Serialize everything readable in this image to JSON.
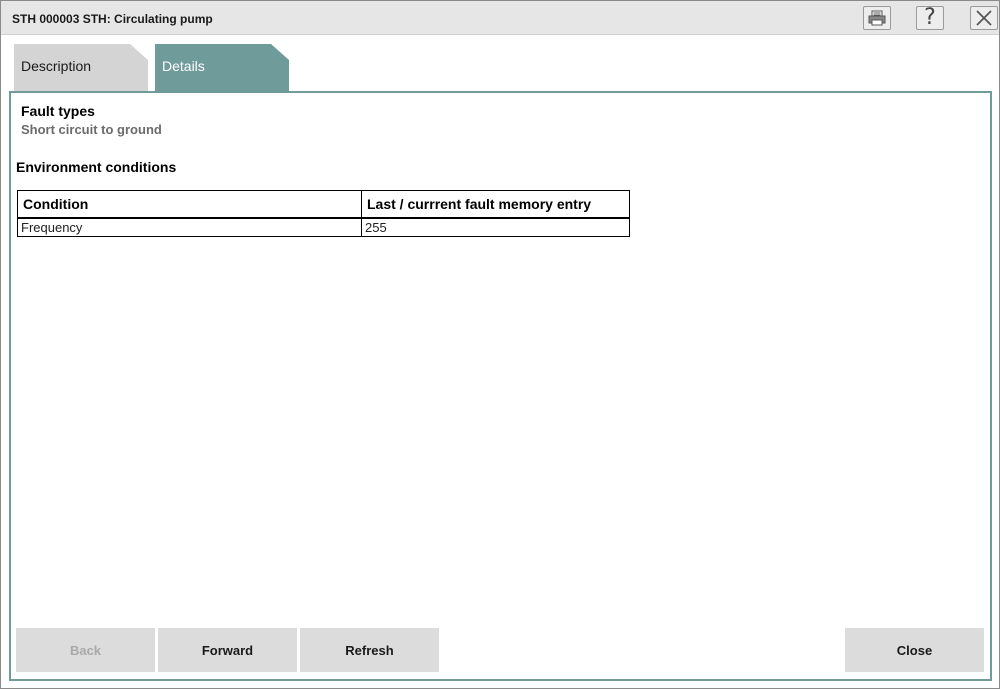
{
  "window": {
    "title": "STH 000003 STH: Circulating pump",
    "toolbar_icons": [
      "print-icon",
      "help-icon",
      "close-icon"
    ],
    "help_glyph": "?"
  },
  "tabs": [
    {
      "label": "Description",
      "active": false
    },
    {
      "label": "Details",
      "active": true
    }
  ],
  "details": {
    "fault_types_heading": "Fault types",
    "fault_type_value": "Short circuit to ground",
    "environment_heading": "Environment conditions",
    "table": {
      "headers": [
        "Condition",
        "Last / currrent fault memory entry"
      ],
      "rows": [
        [
          "Frequency",
          "255"
        ]
      ]
    }
  },
  "buttons": {
    "back": {
      "label": "Back",
      "enabled": false
    },
    "forward": {
      "label": "Forward",
      "enabled": true
    },
    "refresh": {
      "label": "Refresh",
      "enabled": true
    },
    "close": {
      "label": "Close",
      "enabled": true
    }
  },
  "colors": {
    "accent": "#6f9b9a",
    "tab_inactive": "#d4d4d4",
    "button_bg": "#dcdcdc",
    "titlebar_bg": "#e6e6e6"
  }
}
